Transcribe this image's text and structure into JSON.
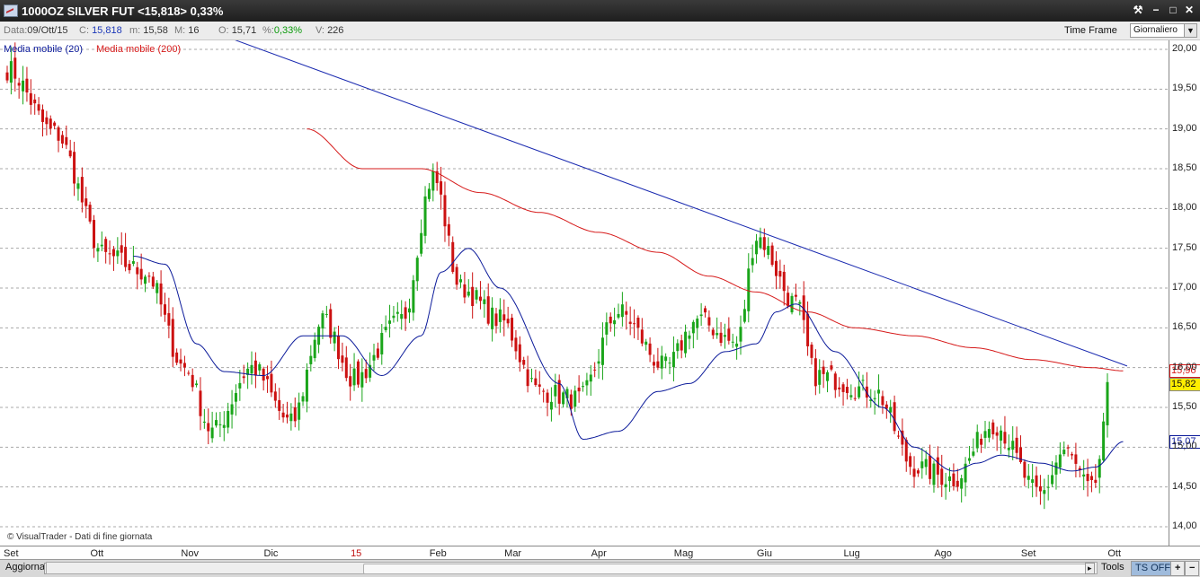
{
  "window": {
    "title": "1000OZ SILVER FUT <15,818> 0,33%",
    "buttons": [
      "⚒",
      "−",
      "□",
      "✕"
    ]
  },
  "info": {
    "data_label": "Data:",
    "data_value": "09/Ott/15",
    "close_label": "C:",
    "close_value": "15,818",
    "min_label": "m:",
    "min_value": "15,58",
    "max_label": "M:",
    "max_value": "16",
    "open_label": "O:",
    "open_value": "15,71",
    "pct_label": "%:",
    "pct_value": "0,33%",
    "vol_label": "V:",
    "vol_value": "226",
    "timeframe_label": "Time Frame",
    "timeframe_value": "Giornaliero"
  },
  "legend": {
    "ma20": "Media mobile (20)",
    "ma200": "Media mobile (200)"
  },
  "colors": {
    "up": "#1aa51a",
    "down": "#cc1111",
    "ma20": "#0b1a9a",
    "ma200": "#d61a1a",
    "trendline": "#1a2ab0",
    "grid": "#a8a8a8",
    "label_ma200_bg": "#ffffff",
    "label_price_bg": "#ffee00",
    "label_ma20_bg": "#ffffff"
  },
  "value_labels": {
    "ma200": "15,96",
    "price": "15,82",
    "ma20": "15,07"
  },
  "copyright": "© VisualTrader - Dati di fine giornata",
  "bottom": {
    "aggiorna": "Aggiorna",
    "tools": "Tools",
    "ts_off": "TS OFF",
    "plus": "+",
    "arrow": "▸"
  },
  "chart_data": {
    "type": "candlestick",
    "y_ticks": [
      "14,00",
      "14,50",
      "15,00",
      "15,50",
      "16,00",
      "16,50",
      "17,00",
      "17,50",
      "18,00",
      "18,50",
      "19,00",
      "19,50",
      "20,00"
    ],
    "ylim": [
      13.9,
      20.05
    ],
    "x_ticks": [
      {
        "label": "Set",
        "highlight": false
      },
      {
        "label": "Ott",
        "highlight": false
      },
      {
        "label": "Nov",
        "highlight": false
      },
      {
        "label": "Dic",
        "highlight": false
      },
      {
        "label": "15",
        "highlight": true
      },
      {
        "label": "Feb",
        "highlight": false
      },
      {
        "label": "Mar",
        "highlight": false
      },
      {
        "label": "Apr",
        "highlight": false
      },
      {
        "label": "Mag",
        "highlight": false
      },
      {
        "label": "Giu",
        "highlight": false
      },
      {
        "label": "Lug",
        "highlight": false
      },
      {
        "label": "Ago",
        "highlight": false
      },
      {
        "label": "Set",
        "highlight": false
      },
      {
        "label": "Ott",
        "highlight": false
      }
    ],
    "bars_count": 280,
    "close_anchors": [
      [
        0,
        19.75
      ],
      [
        12,
        18.95
      ],
      [
        25,
        17.4
      ],
      [
        35,
        17.2
      ],
      [
        45,
        16.0
      ],
      [
        52,
        15.2
      ],
      [
        62,
        16.0
      ],
      [
        72,
        15.3
      ],
      [
        80,
        16.6
      ],
      [
        88,
        15.85
      ],
      [
        100,
        16.6
      ],
      [
        108,
        18.4
      ],
      [
        115,
        17.0
      ],
      [
        125,
        16.6
      ],
      [
        135,
        15.7
      ],
      [
        145,
        15.6
      ],
      [
        155,
        16.7
      ],
      [
        167,
        16.0
      ],
      [
        175,
        16.6
      ],
      [
        185,
        16.3
      ],
      [
        190,
        17.65
      ],
      [
        200,
        16.8
      ],
      [
        205,
        15.9
      ],
      [
        220,
        15.7
      ],
      [
        230,
        14.75
      ],
      [
        240,
        14.6
      ],
      [
        250,
        15.3
      ],
      [
        262,
        14.4
      ],
      [
        268,
        14.95
      ],
      [
        275,
        14.45
      ],
      [
        280,
        15.6
      ],
      [
        283,
        15.82
      ]
    ],
    "ma20_anchors": [
      [
        32,
        17.4
      ],
      [
        40,
        17.3
      ],
      [
        48,
        16.3
      ],
      [
        55,
        15.95
      ],
      [
        65,
        15.9
      ],
      [
        75,
        16.4
      ],
      [
        85,
        16.4
      ],
      [
        95,
        15.9
      ],
      [
        105,
        16.4
      ],
      [
        110,
        17.2
      ],
      [
        117,
        17.5
      ],
      [
        125,
        17.0
      ],
      [
        140,
        15.8
      ],
      [
        146,
        15.1
      ],
      [
        155,
        15.2
      ],
      [
        165,
        15.7
      ],
      [
        173,
        15.8
      ],
      [
        182,
        16.2
      ],
      [
        190,
        16.3
      ],
      [
        195,
        16.7
      ],
      [
        200,
        16.8
      ],
      [
        210,
        16.2
      ],
      [
        222,
        15.5
      ],
      [
        230,
        15.0
      ],
      [
        240,
        14.7
      ],
      [
        246,
        14.8
      ],
      [
        252,
        14.9
      ],
      [
        262,
        14.8
      ],
      [
        270,
        14.7
      ],
      [
        276,
        14.75
      ],
      [
        283,
        15.07
      ]
    ],
    "ma200_anchors": [
      [
        76,
        19.0
      ],
      [
        90,
        18.5
      ],
      [
        105,
        18.5
      ],
      [
        120,
        18.2
      ],
      [
        135,
        17.95
      ],
      [
        150,
        17.7
      ],
      [
        165,
        17.45
      ],
      [
        178,
        17.15
      ],
      [
        190,
        16.95
      ],
      [
        203,
        16.7
      ],
      [
        215,
        16.5
      ],
      [
        230,
        16.4
      ],
      [
        245,
        16.25
      ],
      [
        260,
        16.1
      ],
      [
        275,
        16.0
      ],
      [
        283,
        15.96
      ]
    ],
    "trendline": {
      "from": [
        56,
        20.15
      ],
      "to": [
        284,
        16.02
      ]
    }
  }
}
